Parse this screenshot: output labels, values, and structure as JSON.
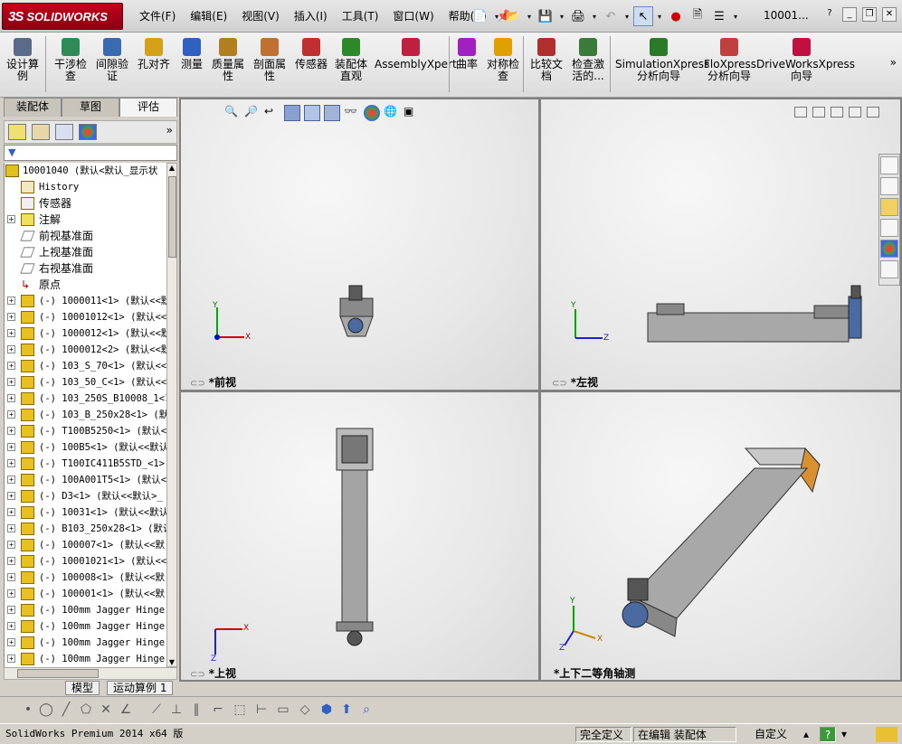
{
  "app": {
    "brand": "SOLIDWORKS",
    "brand_prefix": "3S",
    "doc_name": "10001...",
    "menus": [
      "文件(F)",
      "编辑(E)",
      "视图(V)",
      "插入(I)",
      "工具(T)",
      "窗口(W)",
      "帮助(H)"
    ]
  },
  "commands": [
    {
      "label": "设计算\n例",
      "icon": "design-study-icon",
      "color": "#5a6a8a"
    },
    {
      "label": "干涉检\n查",
      "icon": "interference-check-icon",
      "color": "#2e8b57"
    },
    {
      "label": "间隙验\n证",
      "icon": "clearance-icon",
      "color": "#3a6ab0"
    },
    {
      "label": "孔对齐",
      "icon": "hole-align-icon",
      "color": "#d4a017"
    },
    {
      "label": "测量",
      "icon": "measure-icon",
      "color": "#3060c0"
    },
    {
      "label": "质量属\n性",
      "icon": "mass-properties-icon",
      "color": "#b08020"
    },
    {
      "label": "剖面属\n性",
      "icon": "section-properties-icon",
      "color": "#c07030"
    },
    {
      "label": "传感器",
      "icon": "sensor-icon",
      "color": "#c03030"
    },
    {
      "label": "装配体\n直观",
      "icon": "assembly-visual-icon",
      "color": "#2a8a2a"
    },
    {
      "label": "AssemblyXpert",
      "icon": "assemblyxpert-icon",
      "color": "#c02040"
    },
    {
      "label": "曲率",
      "icon": "curvature-icon",
      "color": "#a020c0"
    },
    {
      "label": "对称检\n查",
      "icon": "symmetry-icon",
      "color": "#e0a000"
    },
    {
      "label": "比较文\n档",
      "icon": "compare-icon",
      "color": "#b03030"
    },
    {
      "label": "检查激\n活的...",
      "icon": "check-active-icon",
      "color": "#3a7a3a"
    },
    {
      "label": "SimulationXpress\n分析向导",
      "icon": "simulationxpress-icon",
      "color": "#2a7a2a"
    },
    {
      "label": "FloXpress\n分析向导",
      "icon": "floxpress-icon",
      "color": "#c04040"
    },
    {
      "label": "DriveWorksXpress\n向导",
      "icon": "driveworksxpress-icon",
      "color": "#c01040"
    }
  ],
  "tabs": [
    "装配体",
    "草图",
    "评估"
  ],
  "active_tab": "评估",
  "tree": {
    "root": "10001040  (默认<默认_显示状",
    "items": [
      {
        "label": "History",
        "icon": "history-icon",
        "mono": true,
        "exp": ""
      },
      {
        "label": "传感器",
        "icon": "sensor-icon",
        "mono": false,
        "exp": ""
      },
      {
        "label": "注解",
        "icon": "annotation-icon",
        "mono": false,
        "exp": "+"
      },
      {
        "label": "前视基准面",
        "icon": "plane-icon",
        "mono": false,
        "exp": ""
      },
      {
        "label": "上视基准面",
        "icon": "plane-icon",
        "mono": false,
        "exp": ""
      },
      {
        "label": "右视基准面",
        "icon": "plane-icon",
        "mono": false,
        "exp": ""
      },
      {
        "label": "原点",
        "icon": "origin-icon",
        "mono": false,
        "exp": ""
      },
      {
        "label": "(-) 1000011<1> (默认<<默",
        "icon": "part-icon",
        "mono": true,
        "exp": "+"
      },
      {
        "label": "(-) 10001012<1> (默认<<",
        "icon": "part-icon",
        "mono": true,
        "exp": "+"
      },
      {
        "label": "(-) 1000012<1> (默认<<默",
        "icon": "part-icon",
        "mono": true,
        "exp": "+"
      },
      {
        "label": "(-) 1000012<2> (默认<<默",
        "icon": "part-icon",
        "mono": true,
        "exp": "+"
      },
      {
        "label": "(-) 103_S_70<1> (默认<<",
        "icon": "part-icon",
        "mono": true,
        "exp": "+"
      },
      {
        "label": "(-) 103_50_C<1> (默认<<",
        "icon": "part-icon",
        "mono": true,
        "exp": "+"
      },
      {
        "label": "(-) 103_250S_B10008_1<1",
        "icon": "part-icon",
        "mono": true,
        "exp": "+"
      },
      {
        "label": "(-) 103_B_250x28<1> (默",
        "icon": "part-icon",
        "mono": true,
        "exp": "+"
      },
      {
        "label": "(-) T100B5250<1> (默认<",
        "icon": "part-icon",
        "mono": true,
        "exp": "+"
      },
      {
        "label": "(-) 100B5<1> (默认<<默认",
        "icon": "part-icon",
        "mono": true,
        "exp": "+"
      },
      {
        "label": "(-) T100IC411B5STD_<1>",
        "icon": "part-icon",
        "mono": true,
        "exp": "+"
      },
      {
        "label": "(-) 100A001T5<1> (默认<",
        "icon": "part-icon",
        "mono": true,
        "exp": "+"
      },
      {
        "label": "(-) D3<1> (默认<<默认>_",
        "icon": "part-icon",
        "mono": true,
        "exp": "+"
      },
      {
        "label": "(-) 10031<1> (默认<<默认",
        "icon": "part-icon",
        "mono": true,
        "exp": "+"
      },
      {
        "label": "(-) B103_250x28<1> (默认",
        "icon": "part-icon",
        "mono": true,
        "exp": "+"
      },
      {
        "label": "(-) 100007<1> (默认<<默",
        "icon": "part-icon",
        "mono": true,
        "exp": "+"
      },
      {
        "label": "(-) 10001021<1> (默认<<",
        "icon": "part-icon",
        "mono": true,
        "exp": "+"
      },
      {
        "label": "(-) 100008<1> (默认<<默",
        "icon": "part-icon",
        "mono": true,
        "exp": "+"
      },
      {
        "label": "(-) 100001<1> (默认<<默",
        "icon": "part-icon",
        "mono": true,
        "exp": "+"
      },
      {
        "label": "(-) 100mm Jagger Hinge",
        "icon": "part-icon",
        "mono": true,
        "exp": "+"
      },
      {
        "label": "(-) 100mm Jagger Hinge",
        "icon": "part-icon",
        "mono": true,
        "exp": "+"
      },
      {
        "label": "(-) 100mm Jagger Hinge",
        "icon": "part-icon",
        "mono": true,
        "exp": "+"
      },
      {
        "label": "(-) 100mm Jagger Hinge",
        "icon": "part-icon",
        "mono": true,
        "exp": "+"
      }
    ]
  },
  "bottom_tabs": [
    "模型",
    "运动算例 1"
  ],
  "viewports": [
    {
      "label": "*前视",
      "axes": [
        "Y",
        "X"
      ]
    },
    {
      "label": "*左视",
      "axes": [
        "Y",
        "Z"
      ]
    },
    {
      "label": "*上视",
      "axes": [
        "Z",
        "X"
      ]
    },
    {
      "label": "*上下二等角轴测",
      "axes": [
        "Y",
        "X",
        "Z"
      ]
    }
  ],
  "status": {
    "version": "SolidWorks Premium 2014 x64 版",
    "definition": "完全定义",
    "mode": "在编辑 装配体",
    "units": "自定义"
  }
}
